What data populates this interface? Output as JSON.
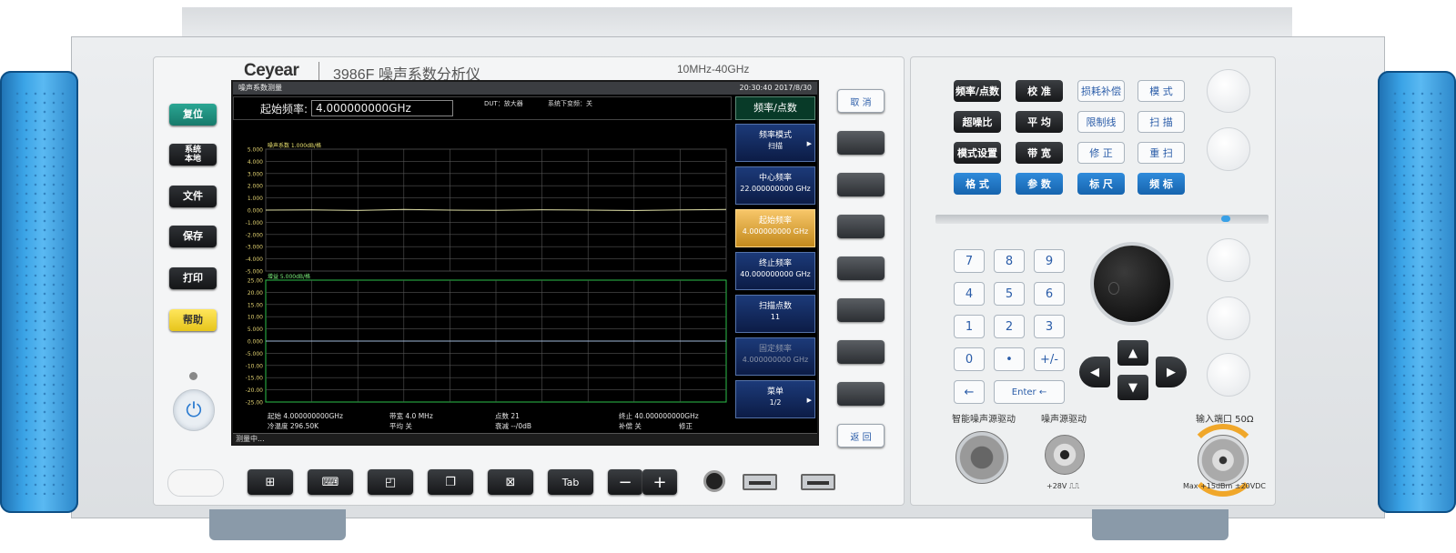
{
  "brand": {
    "logo": "Ceyear",
    "model": "3986F",
    "product": "噪声系数分析仪",
    "range": "10MHz-40GHz"
  },
  "left_keys": [
    {
      "label": "复位",
      "color": "teal"
    },
    {
      "label": "系统\n本地",
      "color": "dark"
    },
    {
      "label": "文件",
      "color": "dark"
    },
    {
      "label": "保存",
      "color": "dark"
    },
    {
      "label": "打印",
      "color": "dark"
    },
    {
      "label": "帮助",
      "color": "yellow"
    }
  ],
  "screen": {
    "title": "噪声系数测量",
    "time": "20:30:40  2017/8/30",
    "start_label": "起始频率:",
    "start_value": "4.000000000GHz",
    "dut": "DUT：放大器",
    "loss_comp": "系统下变频：关",
    "status": "测量中..."
  },
  "softkeys": {
    "header": "频率/点数",
    "items": [
      {
        "title": "频率模式",
        "value": "扫描",
        "state": "normal",
        "arrow": "▶"
      },
      {
        "title": "中心频率",
        "value": "22.000000000 GHz",
        "state": "normal",
        "arrow": ""
      },
      {
        "title": "起始频率",
        "value": "4.000000000 GHz",
        "state": "active",
        "arrow": ""
      },
      {
        "title": "终止频率",
        "value": "40.000000000 GHz",
        "state": "normal",
        "arrow": ""
      },
      {
        "title": "扫描点数",
        "value": "11",
        "state": "normal",
        "arrow": ""
      },
      {
        "title": "固定频率",
        "value": "4.000000000 GHz",
        "state": "dim",
        "arrow": ""
      },
      {
        "title": "菜单",
        "value": "1/2",
        "state": "normal",
        "arrow": "▶"
      }
    ]
  },
  "bezel_keys": {
    "cancel": "取 消",
    "back": "返 回"
  },
  "bottom_keys": {
    "tab": "Tab",
    "minus": "−",
    "plus": "+"
  },
  "right_keys": [
    {
      "label": "频率/点数",
      "style": "dark"
    },
    {
      "label": "校 准",
      "style": "dark"
    },
    {
      "label": "损耗补偿",
      "style": "white"
    },
    {
      "label": "模 式",
      "style": "white"
    },
    {
      "label": "超噪比",
      "style": "dark"
    },
    {
      "label": "平 均",
      "style": "dark"
    },
    {
      "label": "限制线",
      "style": "white"
    },
    {
      "label": "扫 描",
      "style": "white"
    },
    {
      "label": "模式设置",
      "style": "dark"
    },
    {
      "label": "带 宽",
      "style": "dark"
    },
    {
      "label": "修 正",
      "style": "white"
    },
    {
      "label": "重 扫",
      "style": "white"
    },
    {
      "label": "格 式",
      "style": "blue"
    },
    {
      "label": "参 数",
      "style": "blue"
    },
    {
      "label": "标 尺",
      "style": "blue"
    },
    {
      "label": "频 标",
      "style": "blue"
    }
  ],
  "numpad": [
    "7",
    "8",
    "9",
    "4",
    "5",
    "6",
    "1",
    "2",
    "3",
    "0",
    "•",
    "+/-"
  ],
  "numpad_extra": {
    "backspace": "←",
    "enter": "Enter ←"
  },
  "dpad": {
    "up": "▲",
    "down": "▼",
    "left": "◀",
    "right": "▶"
  },
  "connectors": {
    "smart_noise": "智能噪声源驱动",
    "noise_drive": "噪声源驱动",
    "noise_voltage": "+28V ⎍⎍",
    "input": "输入端口  50Ω",
    "input_spec": "Max +15dBm  ±20VDC"
  },
  "colors": {
    "handle": "#3aa3e6",
    "softkey": "#1c3a79",
    "softkey_active": "#f7c669",
    "trace1": "#d9d9a0",
    "trace2": "#9fb7d9"
  },
  "chart_data": [
    {
      "type": "line",
      "ylabel": "噪声系数  1.000dB/格",
      "ylim": [
        -5.0,
        5.0
      ],
      "yticks": [
        "5.000",
        "4.000",
        "3.000",
        "2.000",
        "1.000",
        "0.000",
        "-1.000",
        "-2.000",
        "-3.000",
        "-4.000",
        "-5.000"
      ],
      "series": [
        {
          "values": [
            0.0,
            0.02,
            -0.03,
            0.05,
            0.0,
            -0.02,
            0.03,
            0.0,
            -0.04,
            0.02,
            0.05
          ]
        }
      ],
      "grid": true
    },
    {
      "type": "line",
      "ylabel": "增益  5.000dB/格",
      "ylim": [
        -25.0,
        25.0
      ],
      "yticks": [
        "25.00",
        "20.00",
        "15.00",
        "10.00",
        "5.000",
        "0.000",
        "-5.000",
        "-10.00",
        "-15.00",
        "-20.00",
        "-25.00"
      ],
      "series": [
        {
          "values": [
            0.0,
            0.0,
            0.0,
            0.0,
            0.0,
            0.0,
            0.0,
            0.0,
            0.0,
            0.0,
            0.0
          ]
        }
      ],
      "grid": true
    }
  ],
  "chart_footer": [
    {
      "label": "起始",
      "value": "4.000000000GHz"
    },
    {
      "label": "带宽",
      "value": "4.0  MHz"
    },
    {
      "label": "点数",
      "value": "21"
    },
    {
      "label": "终止",
      "value": "40.000000000GHz"
    },
    {
      "label": "冷温度",
      "value": "296.50K"
    },
    {
      "label": "平均",
      "value": "关"
    },
    {
      "label": "衰减",
      "value": "--/0dB"
    },
    {
      "label": "补偿",
      "value": "关"
    },
    {
      "label": "",
      "value": "修正"
    }
  ]
}
